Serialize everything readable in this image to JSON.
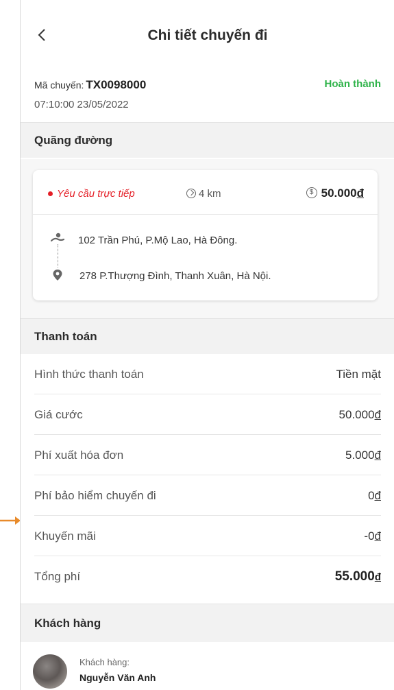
{
  "header": {
    "back_icon": "chevron-left-icon",
    "title": "Chi tiết chuyến đi"
  },
  "trip": {
    "code_label": "Mã chuyến:",
    "code": "TX0098000",
    "status": "Hoàn thành",
    "status_color": "#2fb34a",
    "datetime": "07:10:00  23/05/2022"
  },
  "route": {
    "section_title": "Quãng đường",
    "request_type": "Yêu cầu trực tiếp",
    "request_color": "#e41e26",
    "distance": "4 km",
    "price_number": "50.000",
    "currency": "đ",
    "from_address": "102 Trần Phú, P.Mộ Lao, Hà Đông.",
    "to_address": "278 P.Thượng Đình, Thanh Xuân, Hà Nội.",
    "from_icon": "person-walking-icon",
    "to_icon": "map-pin-icon"
  },
  "payment": {
    "section_title": "Thanh toán",
    "rows": [
      {
        "label": "Hình thức thanh toán",
        "value": "Tiền mặt"
      },
      {
        "label": "Giá cước",
        "value": "50.000",
        "currency": "đ"
      },
      {
        "label": "Phí xuất hóa đơn",
        "value": "5.000",
        "currency": "đ"
      },
      {
        "label": "Phí bảo hiểm chuyến đi",
        "value": "0",
        "currency": "đ"
      },
      {
        "label": "Khuyến mãi",
        "value": "-0",
        "currency": "đ"
      },
      {
        "label": "Tổng phí",
        "value": "55.000",
        "currency": "đ"
      }
    ]
  },
  "customer": {
    "section_title": "Khách hàng",
    "label": "Khách hàng:",
    "name": "Nguyễn Văn Anh"
  }
}
